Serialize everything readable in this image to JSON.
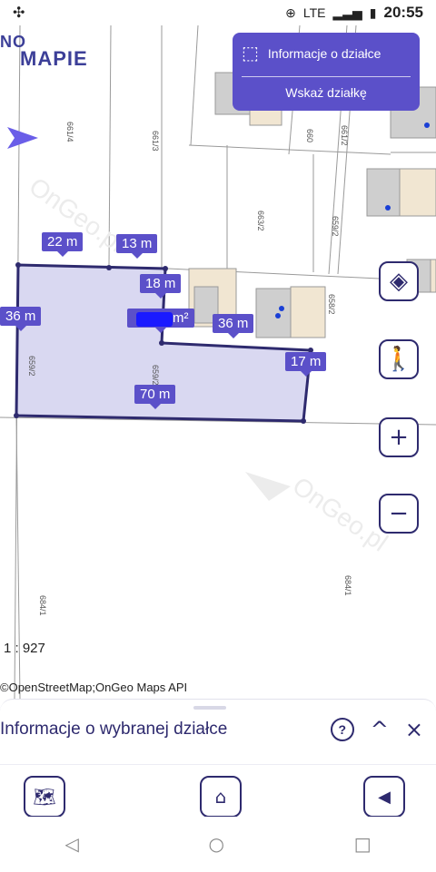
{
  "status_bar": {
    "left_icon": "pinwheel-icon",
    "network": "LTE",
    "time": "20:55"
  },
  "logo": {
    "line1": "NO",
    "line2": "MAPIE"
  },
  "info_panel": {
    "parcel_info_label": "Informacje o działce",
    "show_parcel_label": "Wskaż działkę"
  },
  "map": {
    "parcel_ids": [
      "661/4",
      "661/3",
      "660",
      "661/2",
      "663/2",
      "659/2",
      "658/2",
      "659/2",
      "659/2",
      "684/1",
      "684/1"
    ],
    "measure_labels": [
      "22 m",
      "13 m",
      "18 m",
      "36 m",
      "36 m",
      "17 m",
      "70 m"
    ],
    "area_label": "m²",
    "watermark": "OnGeo.pl",
    "scale": "1 : 927",
    "attribution": "©OpenStreetMap;OnGeo Maps API"
  },
  "controls": {
    "layers": "layers-icon",
    "walk": "walking-person-icon",
    "zoom_in": "+",
    "zoom_out": "−"
  },
  "bottom_sheet": {
    "title": "Informacje o wybranej działce",
    "help": "?",
    "collapse": "^",
    "close": "×"
  },
  "nav": {
    "back": "◁",
    "home": "○",
    "recent": "□"
  },
  "colors": {
    "accent": "#5b50c9",
    "dark": "#2e2a6e",
    "parcel_fill": "#d9d8f1"
  }
}
